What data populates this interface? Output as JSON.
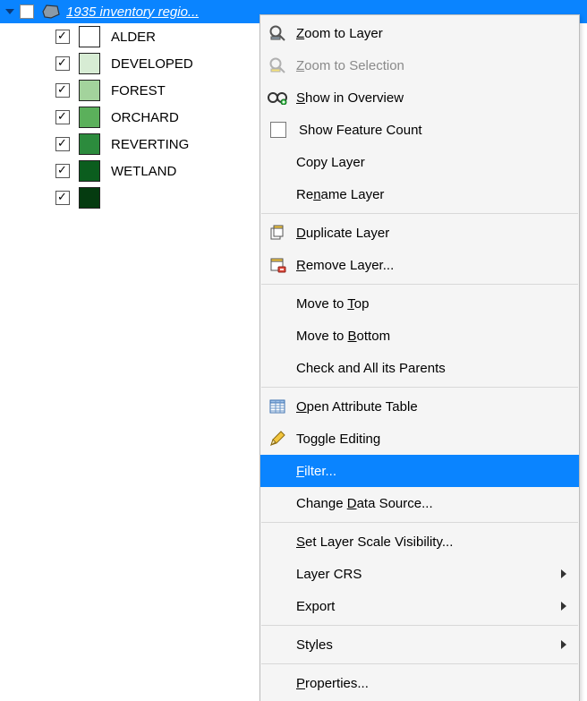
{
  "layer": {
    "name": "1935 inventory regio...",
    "visible": false,
    "expanded": true,
    "classes": [
      {
        "label": "ALDER",
        "color": "#ffffff",
        "checked": true
      },
      {
        "label": "DEVELOPED",
        "color": "#d7ecd4",
        "checked": true
      },
      {
        "label": "FOREST",
        "color": "#a3d39c",
        "checked": true
      },
      {
        "label": "ORCHARD",
        "color": "#5bb05b",
        "checked": true
      },
      {
        "label": "REVERTING",
        "color": "#2c8b3d",
        "checked": true
      },
      {
        "label": "WETLAND",
        "color": "#0b5d1e",
        "checked": true
      },
      {
        "label": "",
        "color": "#053b10",
        "checked": true
      }
    ]
  },
  "menu": {
    "items": [
      {
        "type": "item",
        "icon": "zoom-layer",
        "label": "Zoom to Layer",
        "accel": 0,
        "enabled": true
      },
      {
        "type": "item",
        "icon": "zoom-selection",
        "label": "Zoom to Selection",
        "accel": 0,
        "enabled": false
      },
      {
        "type": "item",
        "icon": "overview",
        "label": "Show in Overview",
        "accel": 0,
        "enabled": true
      },
      {
        "type": "check",
        "label": "Show Feature Count",
        "accel": -1,
        "enabled": true,
        "checked": false
      },
      {
        "type": "item",
        "icon": "",
        "label": "Copy Layer",
        "accel": -1,
        "enabled": true
      },
      {
        "type": "item",
        "icon": "",
        "label": "Rename Layer",
        "accel": 2,
        "enabled": true
      },
      {
        "type": "sep"
      },
      {
        "type": "item",
        "icon": "duplicate",
        "label": "Duplicate Layer",
        "accel": 0,
        "enabled": true
      },
      {
        "type": "item",
        "icon": "remove",
        "label": "Remove Layer...",
        "accel": 0,
        "enabled": true
      },
      {
        "type": "sep"
      },
      {
        "type": "item",
        "icon": "",
        "label": "Move to Top",
        "accel": 8,
        "enabled": true
      },
      {
        "type": "item",
        "icon": "",
        "label": "Move to Bottom",
        "accel": 8,
        "enabled": true
      },
      {
        "type": "item",
        "icon": "",
        "label": "Check and All its Parents",
        "accel": -1,
        "enabled": true
      },
      {
        "type": "sep"
      },
      {
        "type": "item",
        "icon": "attribute",
        "label": "Open Attribute Table",
        "accel": 0,
        "enabled": true
      },
      {
        "type": "item",
        "icon": "pencil",
        "label": "Toggle Editing",
        "accel": -1,
        "enabled": true
      },
      {
        "type": "item",
        "icon": "",
        "label": "Filter...",
        "accel": 0,
        "enabled": true,
        "highlighted": true
      },
      {
        "type": "item",
        "icon": "",
        "label": "Change Data Source...",
        "accel": 7,
        "enabled": true
      },
      {
        "type": "sep"
      },
      {
        "type": "item",
        "icon": "",
        "label": "Set Layer Scale Visibility...",
        "accel": 0,
        "enabled": true
      },
      {
        "type": "sub",
        "icon": "",
        "label": "Layer CRS",
        "accel": -1,
        "enabled": true
      },
      {
        "type": "sub",
        "icon": "",
        "label": "Export",
        "accel": -1,
        "enabled": true
      },
      {
        "type": "sep"
      },
      {
        "type": "sub",
        "icon": "",
        "label": "Styles",
        "accel": -1,
        "enabled": true
      },
      {
        "type": "sep"
      },
      {
        "type": "item",
        "icon": "",
        "label": "Properties...",
        "accel": 0,
        "enabled": true
      }
    ]
  },
  "icons": {
    "polygon_fill": "#8a9aa8",
    "polygon_stroke": "#4a5560"
  }
}
